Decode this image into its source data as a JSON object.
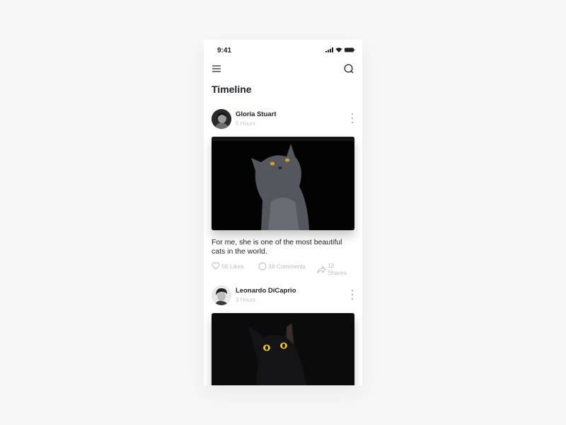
{
  "status_bar": {
    "time": "9:41"
  },
  "header": {
    "title": "Timeline"
  },
  "icons": {
    "menu": "menu-icon",
    "search": "search-icon",
    "more": "more-vertical-icon",
    "like": "heart-icon",
    "comment": "comment-icon",
    "share": "share-icon"
  },
  "posts": [
    {
      "author": "Gloria Stuart",
      "time_ago": "5 Hours",
      "image_alt": "Grey cat looking up on black background",
      "caption": "For me, she is one of the most beautiful cats in the world.",
      "likes": "56 Likes",
      "comments": "38 Comments",
      "shares": "12 Shares"
    },
    {
      "author": "Leonardo DiCaprio",
      "time_ago": "3 Hours",
      "image_alt": "Black cat with yellow eyes on dark background"
    }
  ]
}
